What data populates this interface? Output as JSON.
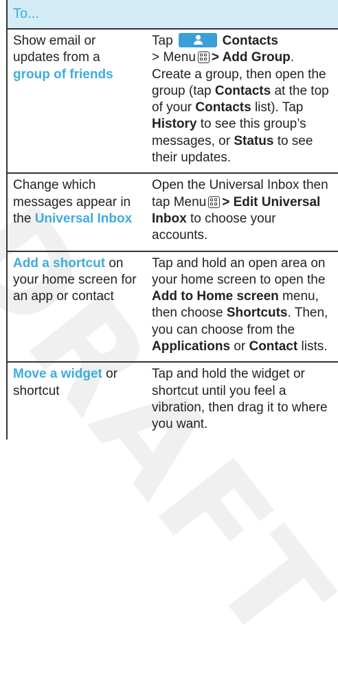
{
  "watermark": "DRAFT",
  "header": {
    "title": "To..."
  },
  "rows": [
    {
      "c1": [
        "Show email or",
        "updates from a"
      ],
      "c1_hl": "group of friends",
      "c2_tap": "Tap",
      "c2_contacts": "Contacts",
      "c2_menu_prefix": "> Menu",
      "c2_add_group": "> Add Group",
      "c2_t1": ". Create a group, then open the group (tap",
      "c2_contacts2": "Contacts",
      "c2_t2": "at the top of your",
      "c2_contacts3": "Contacts",
      "c2_t3": "list). Tap",
      "c2_history": "History",
      "c2_t4": "to see this group’s messages, or",
      "c2_status": "Status",
      "c2_t5": "to see their updates."
    },
    {
      "c1": [
        "Change which",
        "messages appear in",
        "the"
      ],
      "c1_hl": "Universal Inbox",
      "c2_t1": "Open the Universal Inbox then tap Menu",
      "c2_edit": "> Edit Universal Inbox",
      "c2_t2": "to choose your accounts."
    },
    {
      "c1_hl": "Add a shortcut",
      "c1_rest": "on your home screen for an app or contact",
      "c2_t1": "Tap and hold an open area on your home screen to open the",
      "c2_b1": "Add to Home screen",
      "c2_t2": "menu, then choose",
      "c2_b2": "Shortcuts",
      "c2_t3": ". Then, you can choose from the",
      "c2_b3": "Applications",
      "c2_t4": "or",
      "c2_b4": "Contact",
      "c2_t5": "lists."
    },
    {
      "c1_hl": "Move a widget",
      "c1_rest": "or shortcut",
      "c2_t1": "Tap and hold the widget or shortcut until you feel a vibration, then drag it to where you want."
    }
  ]
}
